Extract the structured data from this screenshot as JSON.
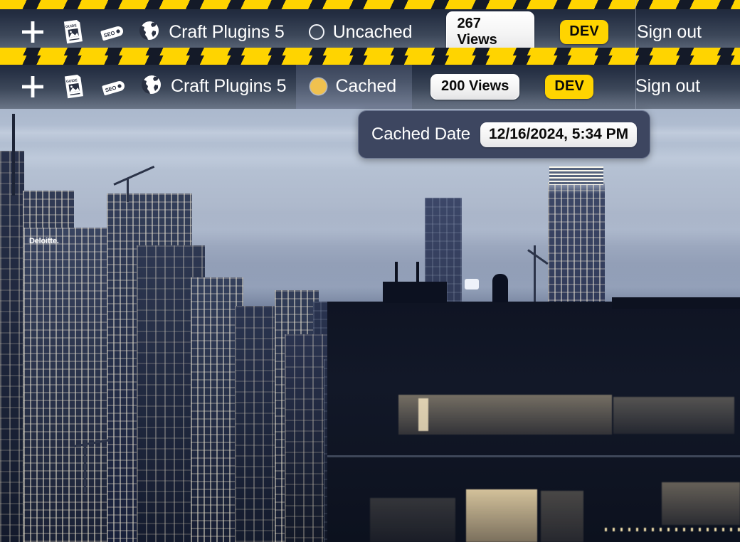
{
  "colors": {
    "hazard_yellow": "#FFD400",
    "hazard_dark": "#141A28",
    "dev_badge_bg": "#FFD400",
    "cached_dot": "#F0C14F",
    "toolbar_top": "#1B2333",
    "toolbar_bottom": "#6A7587",
    "tooltip_bg": "#3D4660"
  },
  "toolbars": [
    {
      "id": "uncached-bar",
      "add_icon": "plus-icon",
      "guide_icon": "guide-document-icon",
      "seo_icon": "seo-tag-icon",
      "globe_icon": "globe-icon",
      "site_name": "Craft Plugins 5",
      "cache_status": "Uncached",
      "cache_dot": "hollow-circle-icon",
      "cache_active": false,
      "views": "267 Views",
      "environment": "DEV",
      "sign_out": "Sign out"
    },
    {
      "id": "cached-bar",
      "add_icon": "plus-icon",
      "guide_icon": "guide-document-icon",
      "seo_icon": "seo-tag-icon",
      "globe_icon": "globe-icon",
      "site_name": "Craft Plugins 5",
      "cache_status": "Cached",
      "cache_dot": "filled-circle-icon",
      "cache_active": true,
      "views": "200 Views",
      "environment": "DEV",
      "sign_out": "Sign out"
    }
  ],
  "tooltip": {
    "label": "Cached Date",
    "value": "12/16/2024, 5:34 PM"
  },
  "background": {
    "scene": "city-skyline-at-dusk",
    "signage": "Deloitte."
  }
}
